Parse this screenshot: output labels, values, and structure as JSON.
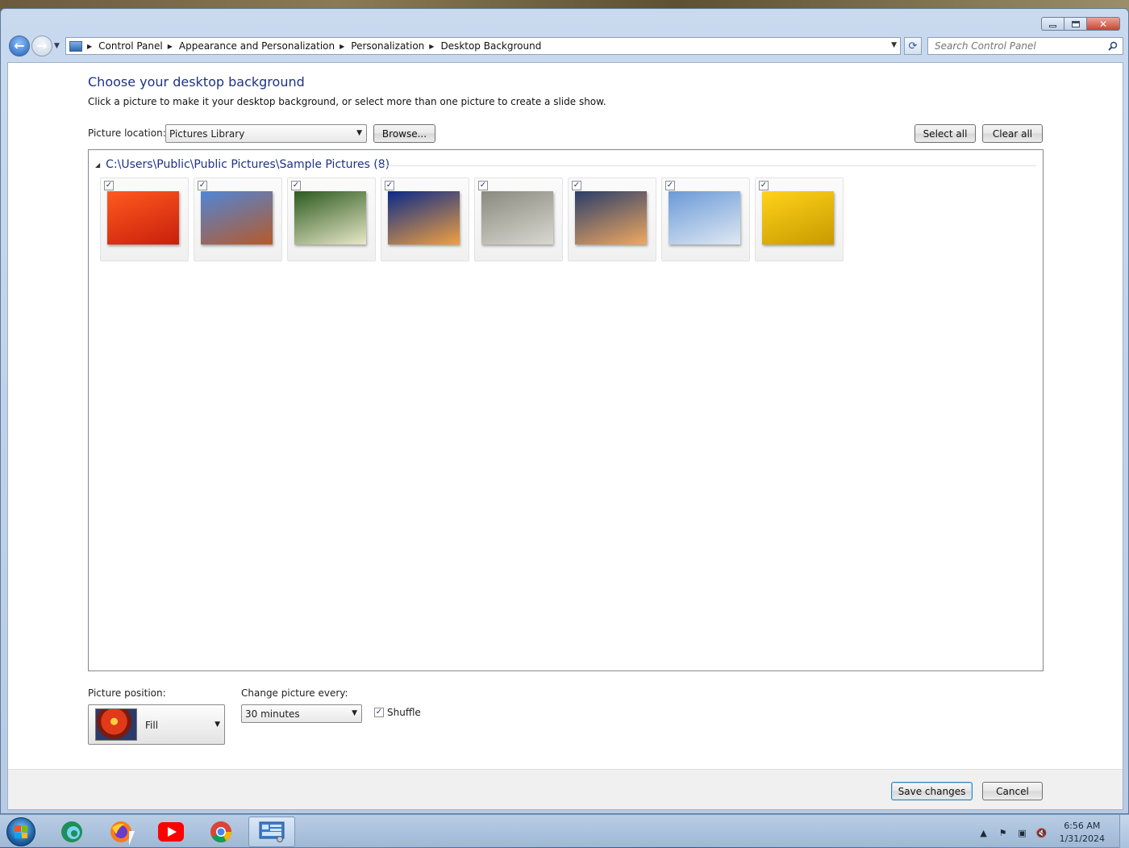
{
  "window": {
    "caption_buttons": [
      "minimize-icon",
      "maximize-icon",
      "close-icon"
    ]
  },
  "navigation": {
    "breadcrumbs": [
      "Control Panel",
      "Appearance and Personalization",
      "Personalization",
      "Desktop Background"
    ],
    "search_placeholder": "Search Control Panel"
  },
  "page": {
    "heading": "Choose your desktop background",
    "subtitle": "Click a picture to make it your desktop background, or select more than one picture to create a slide show.",
    "picture_location_label": "Picture location:",
    "picture_location_value": "Pictures Library",
    "browse_label": "Browse...",
    "select_all_label": "Select all",
    "clear_all_label": "Clear all"
  },
  "gallery": {
    "group_title": "C:\\Users\\Public\\Public Pictures\\Sample Pictures (8)",
    "images": [
      {
        "name": "chrysanthemum-image",
        "checked": true,
        "colors": [
          "#ff5a1f",
          "#c81f0c"
        ]
      },
      {
        "name": "desert-image",
        "checked": true,
        "colors": [
          "#4f86d6",
          "#b65a2b"
        ]
      },
      {
        "name": "hydrangeas-image",
        "checked": true,
        "colors": [
          "#2d5a1f",
          "#e8e8c8"
        ]
      },
      {
        "name": "jellyfish-image",
        "checked": true,
        "colors": [
          "#0a2a8a",
          "#f0a040"
        ]
      },
      {
        "name": "koala-image",
        "checked": true,
        "colors": [
          "#8a8a80",
          "#d8d8d0"
        ]
      },
      {
        "name": "lighthouse-image",
        "checked": true,
        "colors": [
          "#2a3e6a",
          "#f0a860"
        ]
      },
      {
        "name": "penguins-image",
        "checked": true,
        "colors": [
          "#6a9ad8",
          "#dfe8f2"
        ]
      },
      {
        "name": "tulips-image",
        "checked": true,
        "colors": [
          "#ffd21a",
          "#c89a00"
        ]
      }
    ]
  },
  "settings": {
    "picture_position_label": "Picture position:",
    "picture_position_value": "Fill",
    "change_every_label": "Change picture every:",
    "change_every_value": "30 minutes",
    "shuffle_label": "Shuffle",
    "shuffle_checked": true
  },
  "footer": {
    "save_label": "Save changes",
    "cancel_label": "Cancel"
  },
  "taskbar": {
    "time": "6:56 AM",
    "date": "1/31/2024",
    "apps": [
      "start-orb",
      "edge-icon",
      "firefox-icon",
      "youtube-icon",
      "chrome-icon",
      "control-panel-icon"
    ]
  }
}
